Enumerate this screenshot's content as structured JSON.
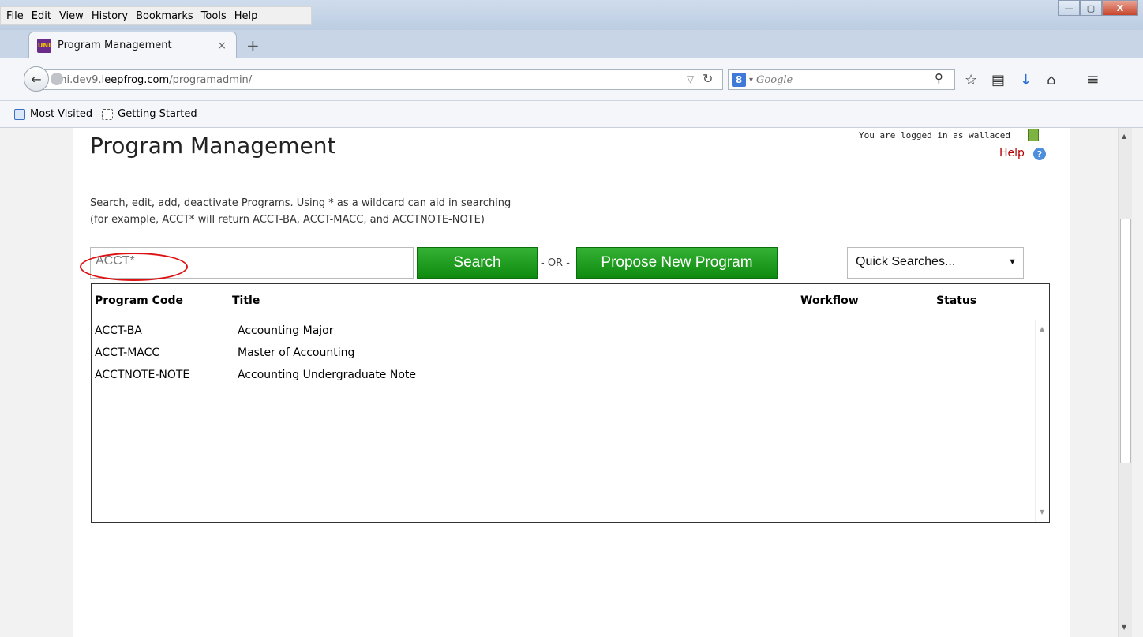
{
  "menu": [
    "File",
    "Edit",
    "View",
    "History",
    "Bookmarks",
    "Tools",
    "Help"
  ],
  "window_controls": {
    "minimize": "—",
    "maximize": "▢",
    "close": "X"
  },
  "tab": {
    "title": "Program Management",
    "favicon": "UNI",
    "close": "×",
    "new_tab": "+"
  },
  "nav": {
    "url_host": "uni.dev9.",
    "url_domain": "leepfrog.com",
    "url_path": "/programadmin/",
    "search_engine": "8",
    "search_placeholder": "Google"
  },
  "bookmarks": [
    "Most Visited",
    "Getting Started"
  ],
  "page": {
    "title": "Program Management",
    "login_text": "You are logged in as wallaced",
    "help": "Help",
    "description_line1": "Search, edit, add, deactivate Programs. Using * as a wildcard can aid in searching",
    "description_line2": "(for example, ACCT* will return ACCT-BA, ACCT-MACC, and ACCTNOTE-NOTE)",
    "search_value": "ACCT*",
    "search_button": "Search",
    "or_text": "- OR -",
    "propose_button": "Propose New Program",
    "quick_searches": "Quick Searches..."
  },
  "table": {
    "headers": {
      "code": "Program Code",
      "title": "Title",
      "workflow": "Workflow",
      "status": "Status"
    },
    "rows": [
      {
        "code": "ACCT-BA",
        "title": "Accounting Major"
      },
      {
        "code": "ACCT-MACC",
        "title": "Master of Accounting"
      },
      {
        "code": "ACCTNOTE-NOTE",
        "title": "Accounting Undergraduate Note"
      }
    ]
  }
}
